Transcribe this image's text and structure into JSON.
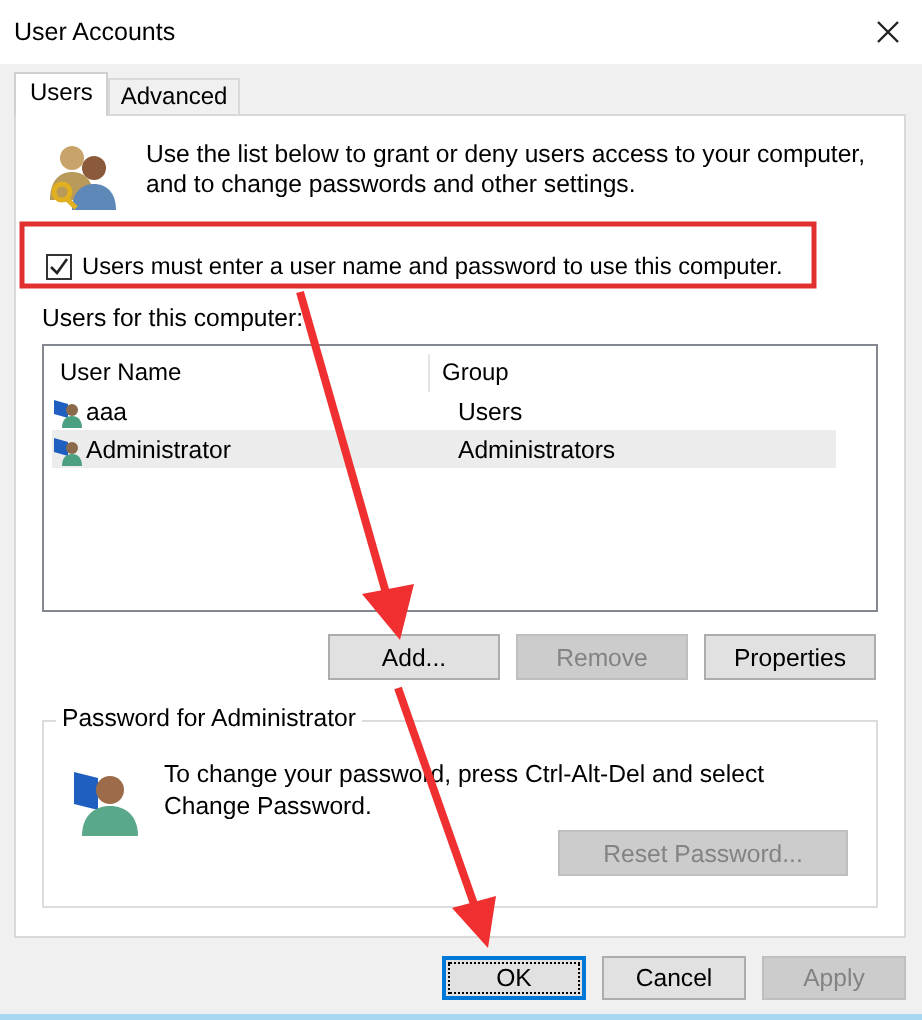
{
  "window": {
    "title": "User Accounts"
  },
  "tabs": [
    {
      "label": "Users",
      "selected": true
    },
    {
      "label": "Advanced",
      "selected": false
    }
  ],
  "intro": "Use the list below to grant or deny users access to your computer, and to change passwords and other settings.",
  "require_password": {
    "label": "Users must enter a user name and password to use this computer.",
    "checked": true
  },
  "users_label": "Users for this computer:",
  "table": {
    "columns": [
      "User Name",
      "Group"
    ],
    "rows": [
      {
        "user_name": "aaa",
        "group": "Users",
        "selected": false
      },
      {
        "user_name": "Administrator",
        "group": "Administrators",
        "selected": true
      }
    ]
  },
  "list_buttons": [
    {
      "label": "Add...",
      "disabled": false
    },
    {
      "label": "Remove",
      "disabled": true
    },
    {
      "label": "Properties",
      "disabled": false
    }
  ],
  "password_group": {
    "title": "Password for Administrator",
    "text": "To change your password, press Ctrl-Alt-Del and select Change Password.",
    "button": {
      "label": "Reset Password...",
      "disabled": true
    }
  },
  "dialog_buttons": [
    {
      "label": "OK",
      "disabled": false,
      "focused": true
    },
    {
      "label": "Cancel",
      "disabled": false,
      "focused": false
    },
    {
      "label": "Apply",
      "disabled": true,
      "focused": false
    }
  ]
}
